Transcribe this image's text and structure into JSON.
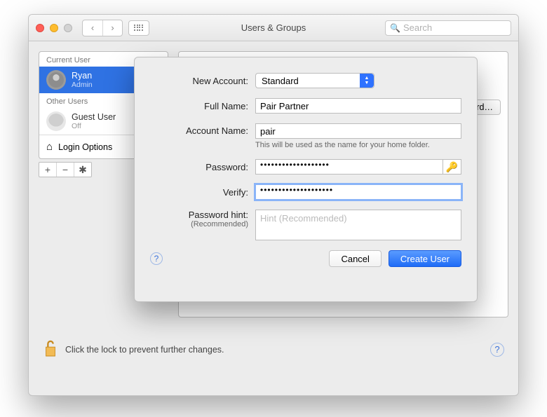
{
  "window": {
    "title": "Users & Groups",
    "search_placeholder": "Search"
  },
  "sidebar": {
    "current_label": "Current User",
    "other_label": "Other Users",
    "current_user": {
      "name": "Ryan",
      "role": "Admin"
    },
    "guest": {
      "name": "Guest User",
      "role": "Off"
    },
    "login_options": "Login Options"
  },
  "rightpane": {
    "password_button": "ord…"
  },
  "lock_hint": "Click the lock to prevent further changes.",
  "sheet": {
    "labels": {
      "new_account": "New Account:",
      "full_name": "Full Name:",
      "account_name": "Account Name:",
      "password": "Password:",
      "verify": "Verify:",
      "password_hint": "Password hint:",
      "recommended": "(Recommended)"
    },
    "values": {
      "account_type": "Standard",
      "full_name": "Pair Partner",
      "account_name": "pair",
      "password_dots": "•••••••••••••••••••",
      "verify_dots": "••••••••••••••••••••",
      "hint_placeholder": "Hint (Recommended)"
    },
    "account_name_hint": "This will be used as the name for your home folder.",
    "buttons": {
      "cancel": "Cancel",
      "create": "Create User"
    }
  }
}
